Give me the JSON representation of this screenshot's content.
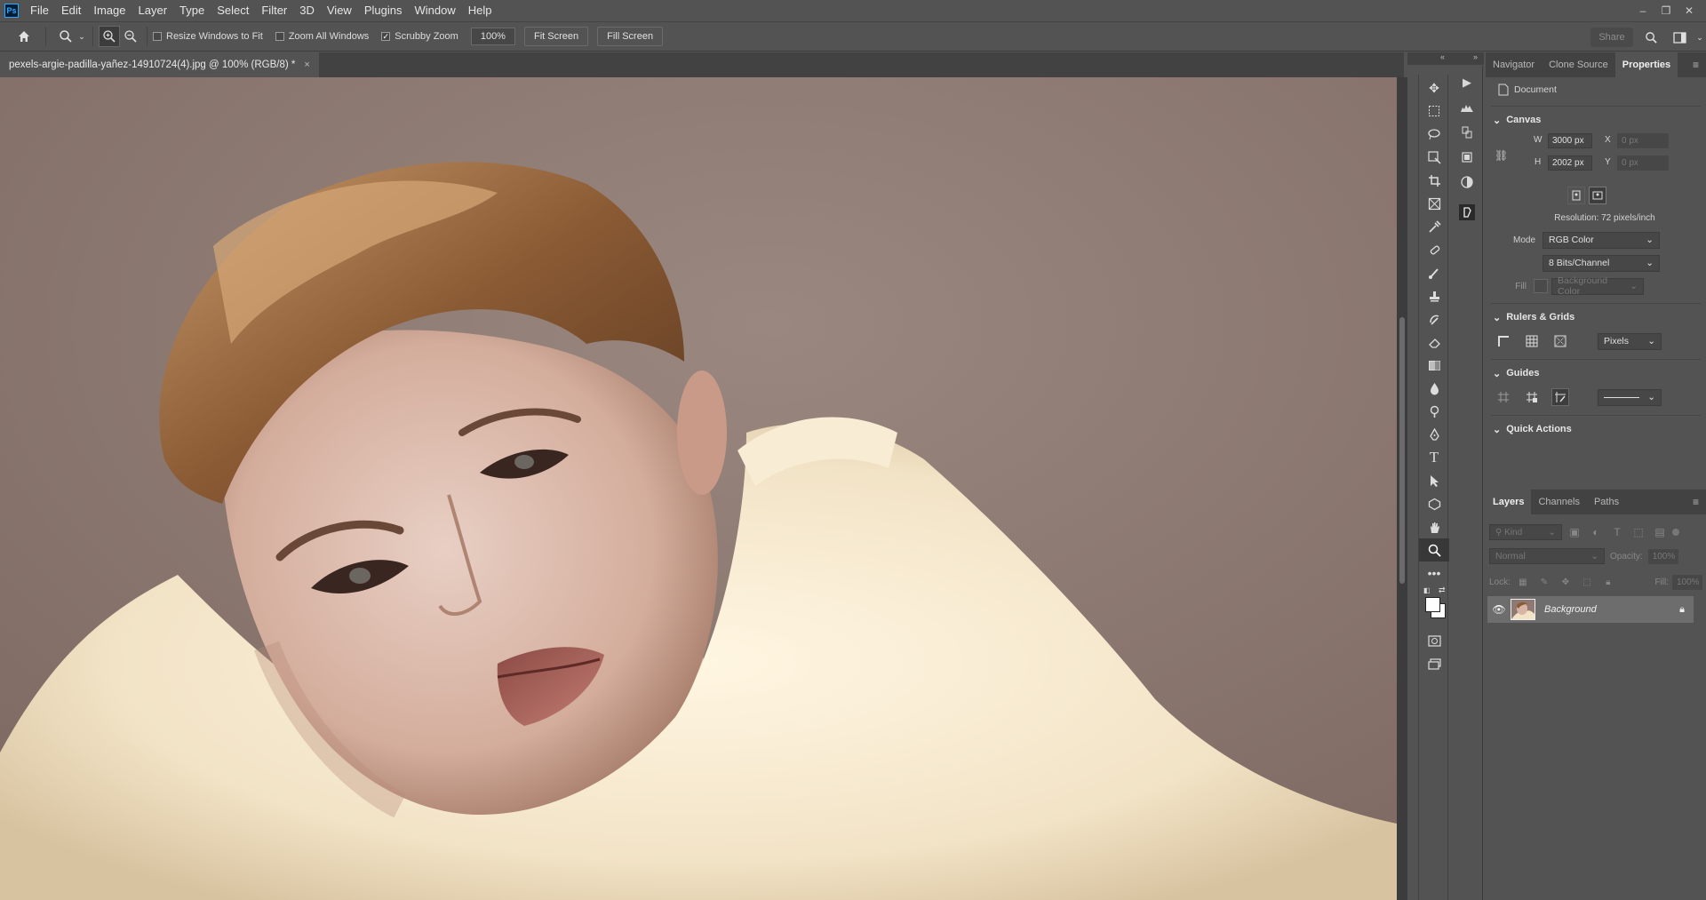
{
  "app": {
    "logo_text": "Ps"
  },
  "menu": [
    "File",
    "Edit",
    "Image",
    "Layer",
    "Type",
    "Select",
    "Filter",
    "3D",
    "View",
    "Plugins",
    "Window",
    "Help"
  ],
  "window_controls": [
    "–",
    "❐",
    "✕"
  ],
  "options": {
    "resize_windows": "Resize Windows to Fit",
    "zoom_all": "Zoom All Windows",
    "scrubby_zoom": "Scrubby Zoom",
    "zoom_value": "100%",
    "fit_screen": "Fit Screen",
    "fill_screen": "Fill Screen",
    "share": "Share",
    "checks": {
      "resize_windows": false,
      "zoom_all": false,
      "scrubby_zoom": true
    }
  },
  "document": {
    "tab_title": "pexels-argie-padilla-yañez-14910724(4).jpg @ 100% (RGB/8) *",
    "close": "×"
  },
  "properties": {
    "tabs": [
      "Navigator",
      "Clone Source",
      "Properties"
    ],
    "active_tab": "Properties",
    "doc_label": "Document",
    "canvas": {
      "title": "Canvas",
      "w_label": "W",
      "w_value": "3000 px",
      "h_label": "H",
      "h_value": "2002 px",
      "x_label": "X",
      "x_value": "0 px",
      "y_label": "Y",
      "y_value": "0 px",
      "resolution": "Resolution: 72 pixels/inch",
      "mode_label": "Mode",
      "mode_value": "RGB Color",
      "bits_value": "8 Bits/Channel",
      "fill_label": "Fill",
      "fill_value": "Background Color"
    },
    "rulers": {
      "title": "Rulers & Grids",
      "units": "Pixels"
    },
    "guides": {
      "title": "Guides"
    },
    "quick_actions": {
      "title": "Quick Actions"
    }
  },
  "layers": {
    "tabs": [
      "Layers",
      "Channels",
      "Paths"
    ],
    "active_tab": "Layers",
    "kind_placeholder": "Kind",
    "blend_mode": "Normal",
    "opacity_label": "Opacity:",
    "opacity_value": "100%",
    "lock_label": "Lock:",
    "fill_label": "Fill:",
    "fill_value": "100%",
    "items": [
      {
        "name": "Background",
        "visible": true,
        "locked": true
      }
    ]
  },
  "colors": {
    "foreground": "#ffffff",
    "background": "#ffffff"
  }
}
